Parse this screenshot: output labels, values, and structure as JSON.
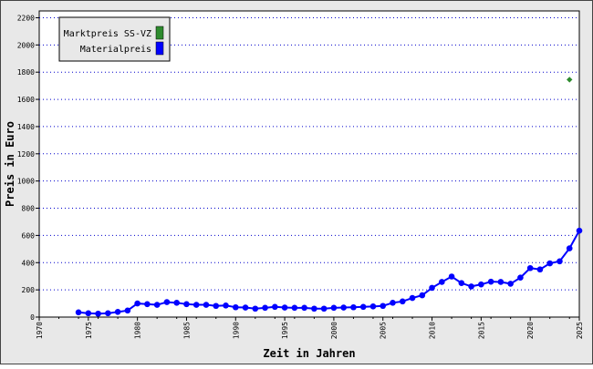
{
  "chart_data": {
    "type": "line",
    "title": "",
    "xlabel": "Zeit in Jahren",
    "ylabel": "Preis in Euro",
    "xlim": [
      1970,
      2025
    ],
    "ylim": [
      0,
      2250
    ],
    "x_ticks": [
      1970,
      1975,
      1980,
      1985,
      1990,
      1995,
      2000,
      2005,
      2010,
      2015,
      2020,
      2025
    ],
    "y_ticks": [
      0,
      200,
      400,
      600,
      800,
      1000,
      1200,
      1400,
      1600,
      1800,
      2000,
      2200
    ],
    "grid": "horizontal dotted",
    "legend_position": "top-left",
    "series": [
      {
        "name": "Marktpreis SS-VZ",
        "color": "#2e8b2e",
        "marker": "diamond",
        "points": [
          {
            "x": 2024,
            "y": 1745
          }
        ]
      },
      {
        "name": "Materialpreis",
        "color": "#0000ff",
        "marker": "circle",
        "points": [
          {
            "x": 1974,
            "y": 35
          },
          {
            "x": 1975,
            "y": 28
          },
          {
            "x": 1976,
            "y": 25
          },
          {
            "x": 1977,
            "y": 28
          },
          {
            "x": 1978,
            "y": 38
          },
          {
            "x": 1979,
            "y": 48
          },
          {
            "x": 1980,
            "y": 100
          },
          {
            "x": 1981,
            "y": 95
          },
          {
            "x": 1982,
            "y": 90
          },
          {
            "x": 1983,
            "y": 110
          },
          {
            "x": 1984,
            "y": 105
          },
          {
            "x": 1985,
            "y": 95
          },
          {
            "x": 1986,
            "y": 90
          },
          {
            "x": 1987,
            "y": 90
          },
          {
            "x": 1988,
            "y": 82
          },
          {
            "x": 1989,
            "y": 85
          },
          {
            "x": 1990,
            "y": 72
          },
          {
            "x": 1991,
            "y": 70
          },
          {
            "x": 1992,
            "y": 62
          },
          {
            "x": 1993,
            "y": 68
          },
          {
            "x": 1994,
            "y": 75
          },
          {
            "x": 1995,
            "y": 70
          },
          {
            "x": 1996,
            "y": 68
          },
          {
            "x": 1997,
            "y": 68
          },
          {
            "x": 1998,
            "y": 62
          },
          {
            "x": 1999,
            "y": 62
          },
          {
            "x": 2000,
            "y": 68
          },
          {
            "x": 2001,
            "y": 70
          },
          {
            "x": 2002,
            "y": 72
          },
          {
            "x": 2003,
            "y": 75
          },
          {
            "x": 2004,
            "y": 78
          },
          {
            "x": 2005,
            "y": 82
          },
          {
            "x": 2006,
            "y": 105
          },
          {
            "x": 2007,
            "y": 115
          },
          {
            "x": 2008,
            "y": 140
          },
          {
            "x": 2009,
            "y": 160
          },
          {
            "x": 2010,
            "y": 215
          },
          {
            "x": 2011,
            "y": 258
          },
          {
            "x": 2012,
            "y": 298
          },
          {
            "x": 2013,
            "y": 250
          },
          {
            "x": 2014,
            "y": 225
          },
          {
            "x": 2015,
            "y": 240
          },
          {
            "x": 2016,
            "y": 260
          },
          {
            "x": 2017,
            "y": 258
          },
          {
            "x": 2018,
            "y": 245
          },
          {
            "x": 2019,
            "y": 290
          },
          {
            "x": 2020,
            "y": 360
          },
          {
            "x": 2021,
            "y": 350
          },
          {
            "x": 2022,
            "y": 395
          },
          {
            "x": 2023,
            "y": 410
          },
          {
            "x": 2024,
            "y": 505
          },
          {
            "x": 2025,
            "y": 635
          }
        ]
      }
    ]
  }
}
